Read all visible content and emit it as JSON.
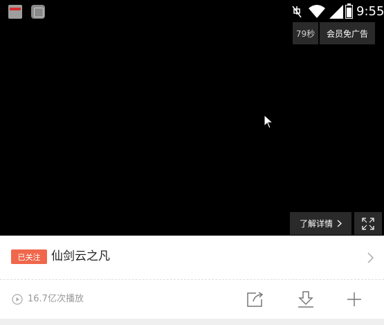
{
  "status_bar": {
    "time": "9:55",
    "icons": [
      "app-icon",
      "app-icon",
      "mute-icon",
      "wifi-icon",
      "signal-icon",
      "battery-icon"
    ]
  },
  "ad": {
    "countdown": "79秒",
    "vip_label": "会员免广告",
    "learn_more_label": "了解详情",
    "learn_more_icon": "chevron-right-icon",
    "fullscreen_icon": "fullscreen-icon"
  },
  "show": {
    "badge": "已关注",
    "title": "仙剑云之凡",
    "more_icon": "chevron-right-icon"
  },
  "meta": {
    "play_count": "16.7亿次播放",
    "actions": [
      "share-icon",
      "download-icon",
      "add-icon"
    ]
  },
  "colors": {
    "accent": "#f0674b",
    "video_bg": "#000000",
    "overlay_bg": "#2a2a2a"
  }
}
